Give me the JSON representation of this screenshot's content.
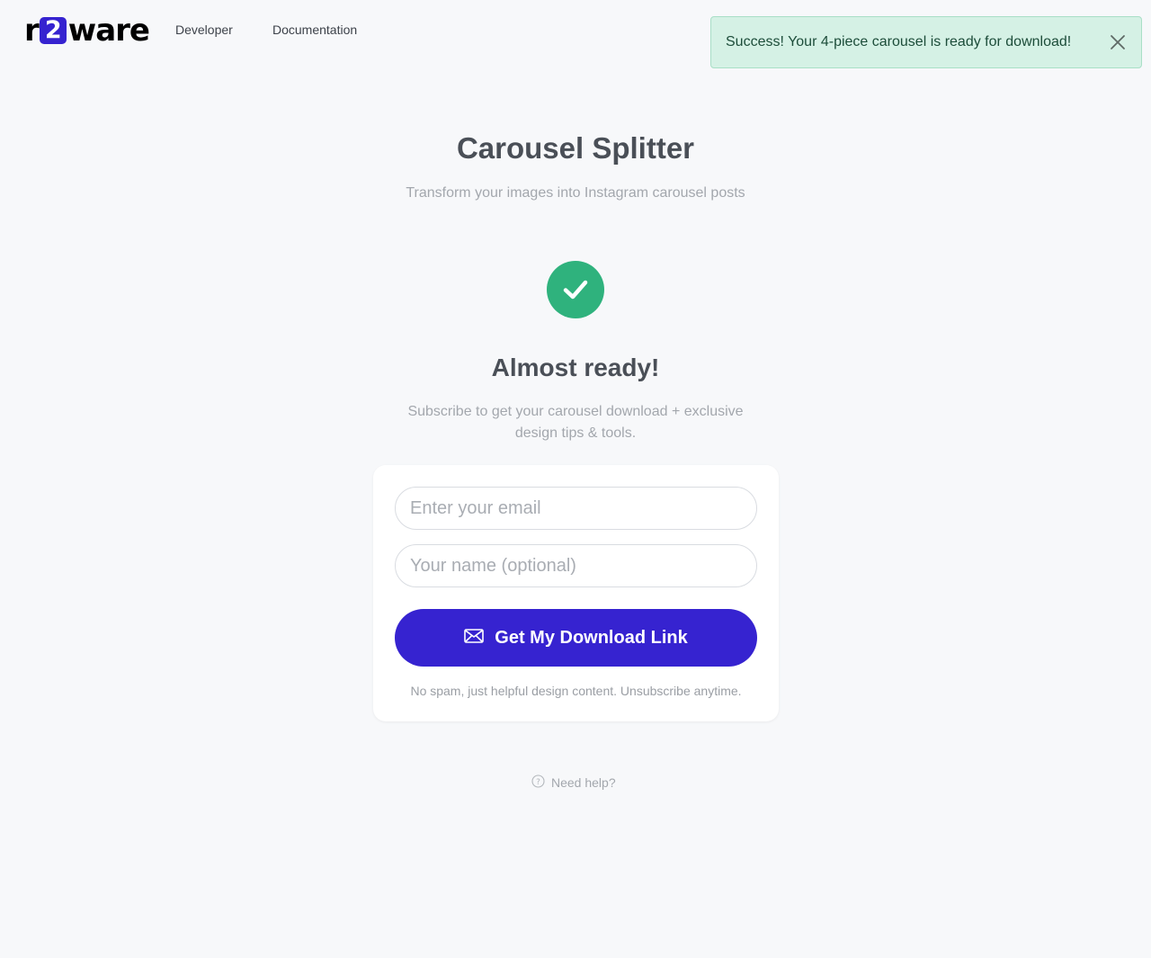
{
  "brand": {
    "logo_left": "r",
    "logo_mark": "2",
    "logo_right": "ware",
    "accent_color": "#3623d0"
  },
  "nav": {
    "developer": "Developer",
    "documentation": "Documentation"
  },
  "toast": {
    "message": "Success! Your 4-piece carousel is ready for download!",
    "close_icon": "close-icon",
    "background_color": "#d5f1e5"
  },
  "main": {
    "title": "Carousel Splitter",
    "subtitle": "Transform your images into Instagram carousel posts",
    "status_icon": "checkmark-icon",
    "status_color": "#2fb27d",
    "ready_heading": "Almost ready!",
    "ready_description": "Subscribe to get your carousel download + exclusive design tips & tools."
  },
  "form": {
    "email_placeholder": "Enter your email",
    "email_value": "",
    "name_placeholder": "Your name (optional)",
    "name_value": "",
    "submit_label": "Get My Download Link",
    "submit_icon": "envelope-icon",
    "fineprint": "No spam, just helpful design content. Unsubscribe anytime."
  },
  "help": {
    "label": "Need help?",
    "icon": "question-circle-icon"
  }
}
